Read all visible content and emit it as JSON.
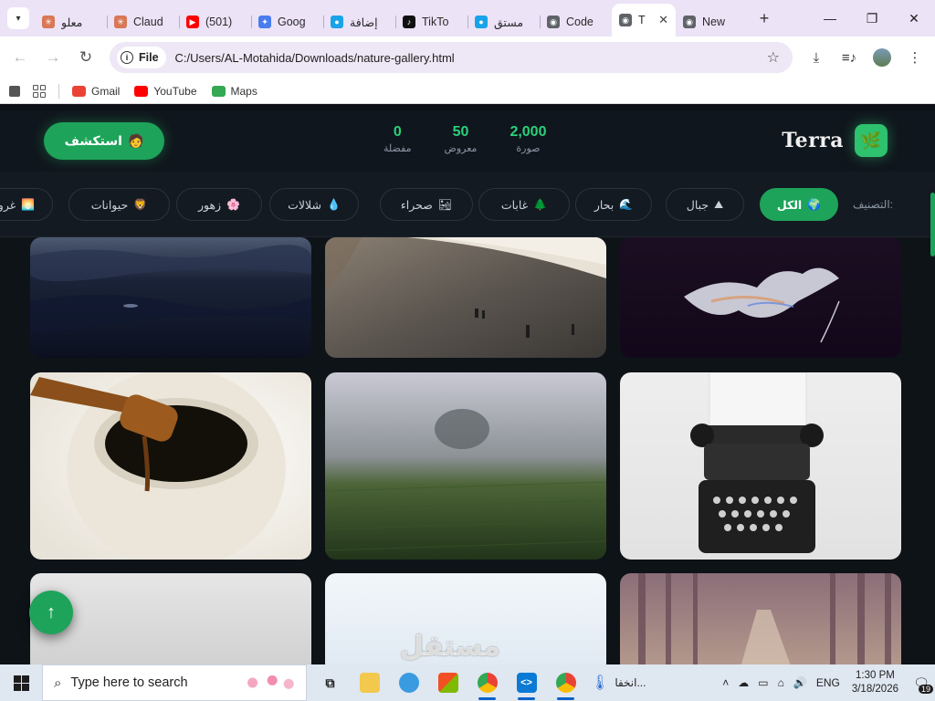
{
  "browser": {
    "tabs": [
      {
        "title": "معلو",
        "fav_color": "#d97757",
        "fav": "✳"
      },
      {
        "title": "Claud",
        "fav_color": "#d97757",
        "fav": "✳"
      },
      {
        "title": "(501)",
        "fav_color": "#ff0000",
        "fav": "▶"
      },
      {
        "title": "Goog",
        "fav_color": "#4a7cf0",
        "fav": "✦"
      },
      {
        "title": "إضافة",
        "fav_color": "#19a3e8",
        "fav": "●"
      },
      {
        "title": "TikTo",
        "fav_color": "#111111",
        "fav": "♪"
      },
      {
        "title": "مستق",
        "fav_color": "#19a3e8",
        "fav": "●"
      },
      {
        "title": "Code",
        "fav_color": "#5f6368",
        "fav": "◉"
      },
      {
        "title": "T",
        "fav_color": "#5f6368",
        "fav": "◉",
        "active": true
      },
      {
        "title": "New",
        "fav_color": "#5f6368",
        "fav": "◉"
      }
    ],
    "scheme": "File",
    "url": "C:/Users/AL-Motahida/Downloads/nature-gallery.html",
    "bookmarks": [
      {
        "label": "Gmail",
        "color": "#ea4335"
      },
      {
        "label": "YouTube",
        "color": "#ff0000"
      },
      {
        "label": "Maps",
        "color": "#34a853"
      }
    ]
  },
  "site": {
    "brand": "Terra",
    "explore_label": "استكشف",
    "stats": [
      {
        "value": "0",
        "label": "مفضلة"
      },
      {
        "value": "50",
        "label": "معروض"
      },
      {
        "value": "2,000",
        "label": "صورة"
      }
    ],
    "filter_label": "التصنيف:",
    "filters": [
      {
        "label": "الكل",
        "emoji": "🌍",
        "active": true
      },
      {
        "label": "جبال",
        "emoji": "⛰"
      },
      {
        "label": "بحار",
        "emoji": "🌊"
      },
      {
        "label": "غابات",
        "emoji": "🌲"
      },
      {
        "label": "صحراء",
        "emoji": "🏜"
      },
      {
        "label": "شلالات",
        "emoji": "💧"
      },
      {
        "label": "زهور",
        "emoji": "🌸"
      },
      {
        "label": "حيوانات",
        "emoji": "🦁"
      },
      {
        "label": "غرو",
        "emoji": "🌅"
      }
    ],
    "gallery": [
      {
        "name": "ocean-waves"
      },
      {
        "name": "hikers-above-clouds"
      },
      {
        "name": "smoke-dark"
      },
      {
        "name": "honey-dipper"
      },
      {
        "name": "misty-field"
      },
      {
        "name": "typewriter"
      },
      {
        "name": "fog-white"
      },
      {
        "name": "bright-sky"
      },
      {
        "name": "forest-path"
      }
    ],
    "scroll_top_icon": "↑",
    "watermark": "مستقل"
  },
  "taskbar": {
    "search_placeholder": "Type here to search",
    "weather_text": "انخفا...",
    "lang": "ENG",
    "time": "1:30 PM",
    "date": "3/18/2026",
    "notif_count": "19"
  },
  "colors": {
    "accent": "#1ea35a",
    "stat_green": "#29d17a",
    "page_bg": "#0e1318",
    "tabstrip": "#ece3f7"
  }
}
